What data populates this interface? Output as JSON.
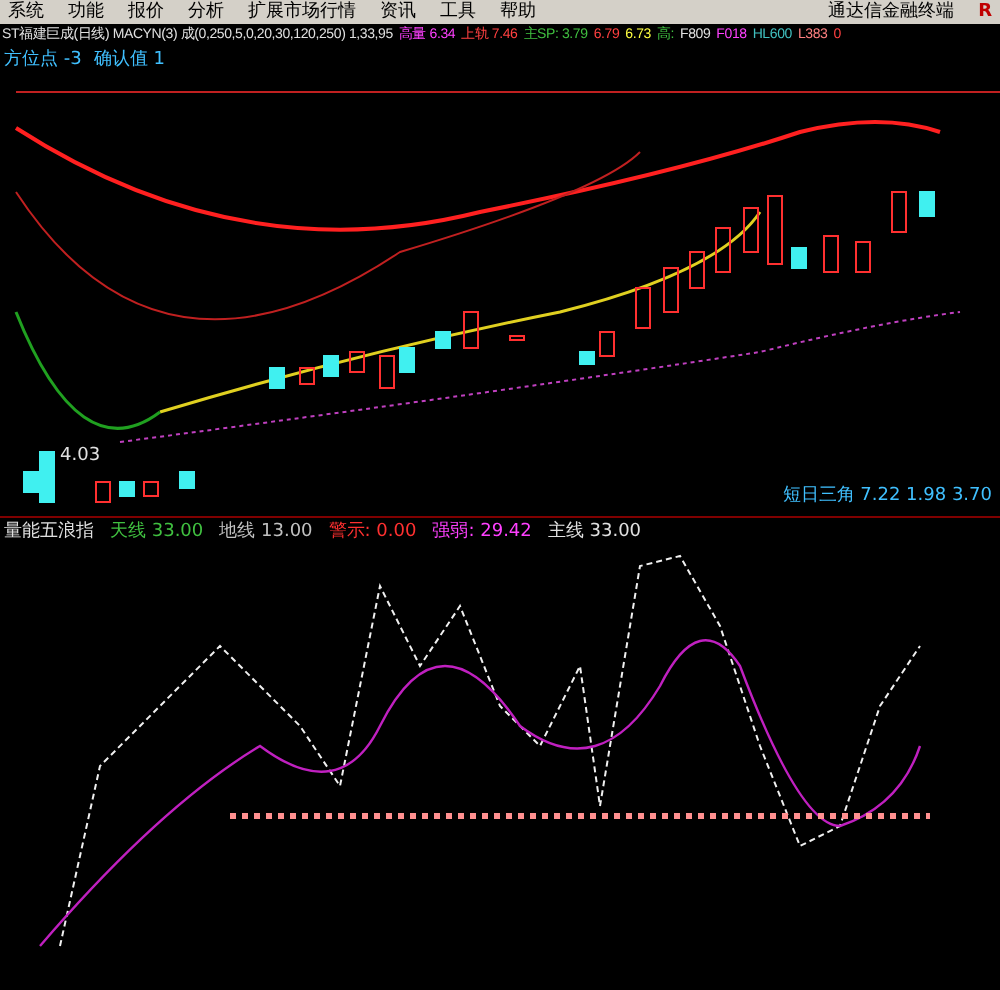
{
  "menu": {
    "items": [
      "系统",
      "功能",
      "报价",
      "分析",
      "扩展市场行情",
      "资讯",
      "工具",
      "帮助"
    ],
    "title": "通达信金融终端",
    "badge": "R"
  },
  "header": {
    "items": [
      {
        "text": "ST福建巨成(日线) MACYN(3) 成(0,250,5,0,20,30,120,250) 1,33,95",
        "color": "#e0e0e0"
      },
      {
        "text": "高量 6.34",
        "color": "#ff40ff"
      },
      {
        "text": "上轨 7.46",
        "color": "#ff4040"
      },
      {
        "text": "主SP: 3.79",
        "color": "#40c040"
      },
      {
        "text": "6.79",
        "color": "#ff4040"
      },
      {
        "text": "6.73",
        "color": "#ffff40"
      },
      {
        "text": "高:",
        "color": "#40c040"
      },
      {
        "text": "F809",
        "color": "#e0e0e0"
      },
      {
        "text": "F018",
        "color": "#ff40ff"
      },
      {
        "text": "HL600",
        "color": "#40c0c0"
      },
      {
        "text": "L383",
        "color": "#ff8080"
      },
      {
        "text": "0",
        "color": "#ff4040"
      }
    ]
  },
  "main_label": {
    "items": [
      {
        "text": "方位点 -3",
        "color": "#40c0ff"
      },
      {
        "text": "确认值 1",
        "color": "#40c0ff"
      }
    ]
  },
  "low_mark": "4.03",
  "lower_label": {
    "items": [
      {
        "text": "量能五浪指",
        "color": "#e0e0e0"
      },
      {
        "text": "天线 33.00",
        "color": "#40c040"
      },
      {
        "text": "地线 13.00",
        "color": "#c0c0c0"
      },
      {
        "text": "警示: 0.00",
        "color": "#ff3030"
      },
      {
        "text": "强弱: 29.42",
        "color": "#ff40ff"
      },
      {
        "text": "主线 33.00",
        "color": "#e0e0e0"
      }
    ]
  },
  "right_label": "短日三角 7.22 1.98 3.70"
}
